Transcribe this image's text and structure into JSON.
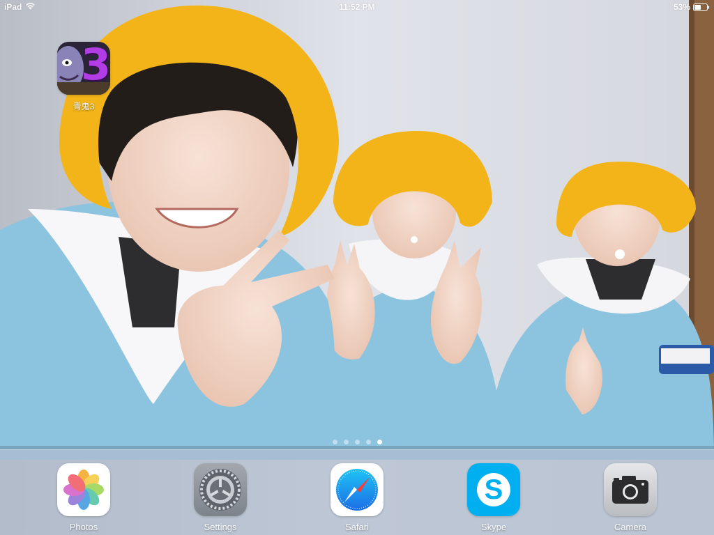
{
  "status_bar": {
    "device": "iPad",
    "time": "11:52 PM",
    "battery": "53%",
    "battery_level": 0.53,
    "wifi_icon": "wifi-icon",
    "battery_icon": "battery-icon"
  },
  "home": {
    "apps": [
      {
        "label": "青鬼3",
        "icon": "aooni3-app-icon",
        "glyph": "3"
      }
    ],
    "page_count": 5,
    "active_page": 5
  },
  "dock": {
    "apps": [
      {
        "label": "Photos",
        "icon": "photos-icon"
      },
      {
        "label": "Settings",
        "icon": "settings-gear-icon"
      },
      {
        "label": "Safari",
        "icon": "safari-compass-icon"
      },
      {
        "label": "Skype",
        "icon": "skype-icon",
        "glyph": "S"
      },
      {
        "label": "Camera",
        "icon": "camera-icon"
      }
    ]
  },
  "colors": {
    "hat": "#f2b418",
    "smock": "#8cc4e0",
    "wall": "#d9dbe3",
    "skype_blue": "#00aff0",
    "aooni_purple": "#a33ad8"
  }
}
